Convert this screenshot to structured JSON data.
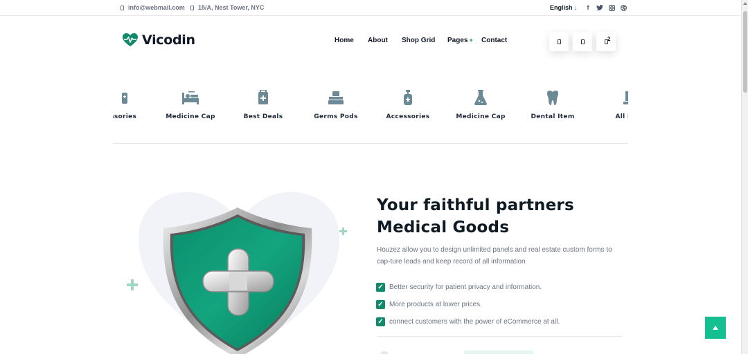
{
  "topbar": {
    "email": "info@webmail.com",
    "address": "15/A, Nest Tower, NYC",
    "language": "English",
    "language_arrow": "↓",
    "social": [
      "facebook-icon",
      "twitter-icon",
      "instagram-icon",
      "dribbble-icon"
    ]
  },
  "header": {
    "brand": "Vicodin",
    "nav": [
      {
        "label": "Home"
      },
      {
        "label": "About"
      },
      {
        "label": "Shop Grid"
      },
      {
        "label": "Pages",
        "suffix": "+"
      },
      {
        "label": "Contact"
      }
    ],
    "cart_count": "2"
  },
  "categories": [
    {
      "label": "essories"
    },
    {
      "label": "Medicine Cap"
    },
    {
      "label": "Best Deals"
    },
    {
      "label": "Germs Pods"
    },
    {
      "label": "Accessories"
    },
    {
      "label": "Medicine Cap"
    },
    {
      "label": "Dental Item"
    },
    {
      "label": "All Pr"
    }
  ],
  "hero": {
    "headline_line1": "Your faithful partners",
    "headline_line2": "Medical Goods",
    "description": "Houzez allow you to design unlimited panels and real estate custom forms to cap-ture leads and keep record of all information",
    "checks": [
      "Better security for patient privacy and information.",
      "More products at lower prices.",
      "connect customers with the power of eCommerce at all."
    ]
  },
  "colors": {
    "accent": "#0f8a6b",
    "accent_light": "#14c08f",
    "icon_gray": "#6b8a96"
  }
}
